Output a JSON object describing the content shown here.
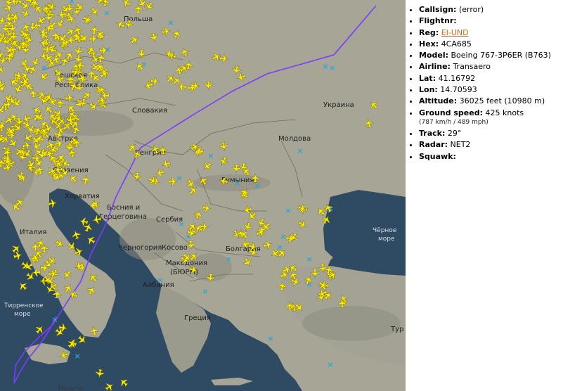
{
  "map": {
    "countries": [
      "Польша",
      "Чешская",
      "Республика",
      "Австрия",
      "Словения",
      "Хорватия",
      "Словакия",
      "Венгрия",
      "Украина",
      "Молдова",
      "Румыния",
      "Босния и",
      "Герцеговина",
      "Сербия",
      "Черногория",
      "Косово",
      "Болгария",
      "Македония",
      "(БЮРМ)",
      "Албания",
      "Греция",
      "Италия",
      "Тур"
    ],
    "seas": [
      "Тирренское",
      "море",
      "Чёрное",
      "море"
    ],
    "cities": [
      "Мальта"
    ]
  },
  "flight": {
    "items": [
      {
        "label": "Callsign:",
        "value": "(error)"
      },
      {
        "label": "Flightnr:",
        "value": ""
      },
      {
        "label": "Reg:",
        "value": "EI-UND",
        "link": true
      },
      {
        "label": "Hex:",
        "value": "4CA685"
      },
      {
        "label": "Model:",
        "value": "Boeing 767-3P6ER (B763)"
      },
      {
        "label": "Airline:",
        "value": "Transaero"
      },
      {
        "label": "Lat:",
        "value": "41.16792"
      },
      {
        "label": "Lon:",
        "value": "14.70593"
      },
      {
        "label": "Altitude:",
        "value": "36025 feet (10980 m)"
      },
      {
        "label": "Ground speed:",
        "value": "425 knots",
        "sub": "(787 km/h / 489 mph)"
      },
      {
        "label": "Track:",
        "value": "29°"
      },
      {
        "label": "Radar:",
        "value": "NET2"
      },
      {
        "label": "Squawk:",
        "value": ""
      }
    ]
  },
  "colors": {
    "track": "#7a3cff",
    "plane": "#ffee00",
    "station": "#2aa7d8",
    "land": "#9a9a8c",
    "water": "#2f4a63"
  }
}
